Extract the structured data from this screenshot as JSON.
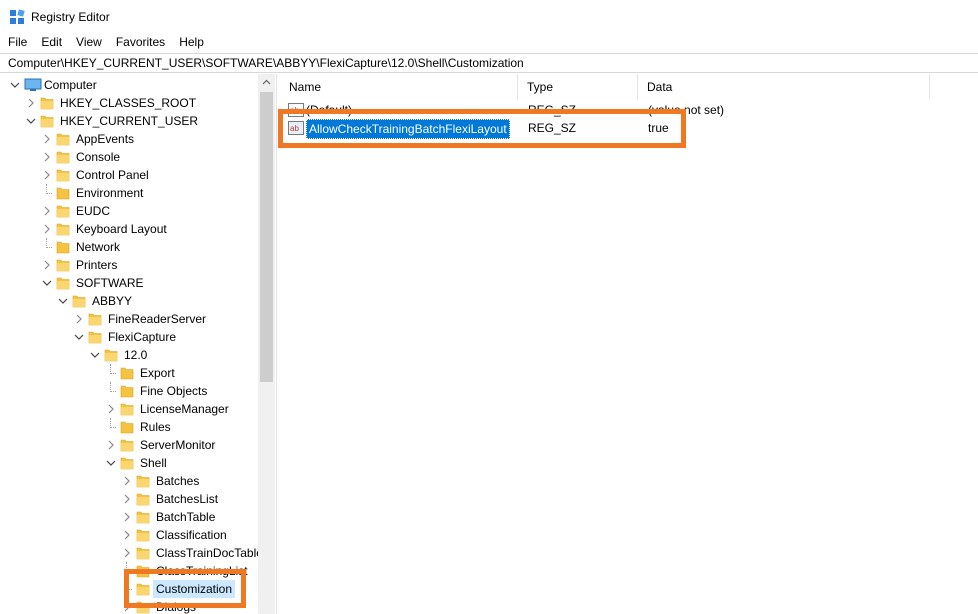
{
  "window": {
    "title": "Registry Editor",
    "icon": "registry-editor-icon"
  },
  "menu": [
    {
      "id": "file",
      "label": "File"
    },
    {
      "id": "edit",
      "label": "Edit"
    },
    {
      "id": "view",
      "label": "View"
    },
    {
      "id": "favorites",
      "label": "Favorites"
    },
    {
      "id": "help",
      "label": "Help"
    }
  ],
  "address": {
    "path": "Computer\\HKEY_CURRENT_USER\\SOFTWARE\\ABBYY\\FlexiCapture\\12.0\\Shell\\Customization"
  },
  "tree": {
    "root": {
      "label": "Computer",
      "icon": "computer-icon",
      "expanded": true
    },
    "items": [
      {
        "label": "HKEY_CLASSES_ROOT",
        "level": 1,
        "toggle": "collapsed"
      },
      {
        "label": "HKEY_CURRENT_USER",
        "level": 1,
        "toggle": "expanded"
      },
      {
        "label": "AppEvents",
        "level": 2,
        "toggle": "collapsed"
      },
      {
        "label": "Console",
        "level": 2,
        "toggle": "collapsed"
      },
      {
        "label": "Control Panel",
        "level": 2,
        "toggle": "collapsed"
      },
      {
        "label": "Environment",
        "level": 2,
        "toggle": "none"
      },
      {
        "label": "EUDC",
        "level": 2,
        "toggle": "collapsed"
      },
      {
        "label": "Keyboard Layout",
        "level": 2,
        "toggle": "collapsed"
      },
      {
        "label": "Network",
        "level": 2,
        "toggle": "none"
      },
      {
        "label": "Printers",
        "level": 2,
        "toggle": "collapsed"
      },
      {
        "label": "SOFTWARE",
        "level": 2,
        "toggle": "expanded"
      },
      {
        "label": "ABBYY",
        "level": 3,
        "toggle": "expanded"
      },
      {
        "label": "FineReaderServer",
        "level": 4,
        "toggle": "collapsed"
      },
      {
        "label": "FlexiCapture",
        "level": 4,
        "toggle": "expanded"
      },
      {
        "label": "12.0",
        "level": 5,
        "toggle": "expanded"
      },
      {
        "label": "Export",
        "level": 6,
        "toggle": "none"
      },
      {
        "label": "Fine Objects",
        "level": 6,
        "toggle": "none"
      },
      {
        "label": "LicenseManager",
        "level": 6,
        "toggle": "collapsed"
      },
      {
        "label": "Rules",
        "level": 6,
        "toggle": "none"
      },
      {
        "label": "ServerMonitor",
        "level": 6,
        "toggle": "collapsed"
      },
      {
        "label": "Shell",
        "level": 6,
        "toggle": "expanded"
      },
      {
        "label": "Batches",
        "level": 7,
        "toggle": "collapsed"
      },
      {
        "label": "BatchesList",
        "level": 7,
        "toggle": "collapsed"
      },
      {
        "label": "BatchTable",
        "level": 7,
        "toggle": "collapsed"
      },
      {
        "label": "Classification",
        "level": 7,
        "toggle": "collapsed"
      },
      {
        "label": "ClassTrainDocTable",
        "level": 7,
        "toggle": "collapsed"
      },
      {
        "label": "ClassTrainingList",
        "level": 7,
        "toggle": "none"
      },
      {
        "label": "Customization",
        "level": 7,
        "toggle": "none",
        "selected": true
      },
      {
        "label": "Dialogs",
        "level": 7,
        "toggle": "collapsed"
      }
    ]
  },
  "list": {
    "columns": [
      {
        "id": "name",
        "label": "Name"
      },
      {
        "id": "type",
        "label": "Type"
      },
      {
        "id": "data",
        "label": "Data"
      }
    ],
    "rows": [
      {
        "name": "(Default)",
        "type": "REG_SZ",
        "data": "(value not set)",
        "icon": "string-value-icon",
        "selected": false
      },
      {
        "name": "AllowCheckTrainingBatchFlexiLayout",
        "type": "REG_SZ",
        "data": "true",
        "icon": "string-value-icon",
        "selected": true
      }
    ]
  },
  "colors": {
    "highlight": "#f07823",
    "selection": "#0078d7",
    "folder": "#f5c242"
  }
}
